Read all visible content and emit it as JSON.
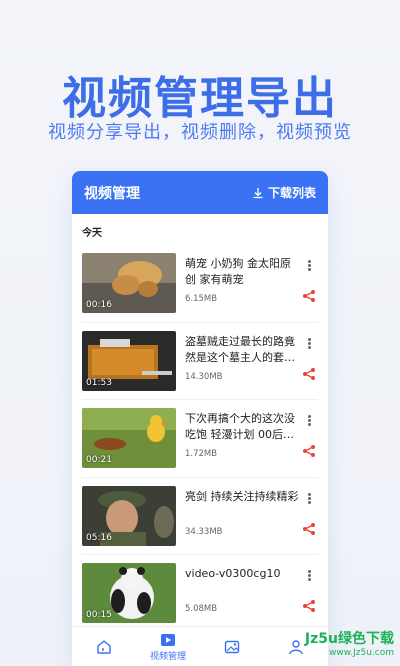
{
  "hero": {
    "title": "视频管理导出",
    "subtitle": "视频分享导出，视频删除，视频预览"
  },
  "app": {
    "title": "视频管理",
    "download_label": "下载列表",
    "section_label": "今天",
    "accent": "#3b72f3",
    "share_color": "#e8453c"
  },
  "videos": [
    {
      "title": "萌宠 小奶狗 金太阳原创 家有萌宠",
      "size": "6.15MB",
      "duration": "00:16"
    },
    {
      "title": "盗墓贼走过最长的路竟然是这个墓主人的套…",
      "size": "14.30MB",
      "duration": "01:53"
    },
    {
      "title": "下次再搞个大的这次没吃饱 轻漫计划 00后…",
      "size": "1.72MB",
      "duration": "00:21"
    },
    {
      "title": "亮剑 持续关注持续精彩",
      "size": "34.33MB",
      "duration": "05:16"
    },
    {
      "title": "video-v0300cg10",
      "size": "5.08MB",
      "duration": "00:15"
    }
  ],
  "nav": {
    "items": [
      {
        "icon": "home-icon",
        "label": ""
      },
      {
        "icon": "video-icon",
        "label": "视频管理"
      },
      {
        "icon": "image-icon",
        "label": ""
      },
      {
        "icon": "user-icon",
        "label": ""
      }
    ]
  },
  "watermark": {
    "main": "Jz5u绿色下载",
    "url": "www.Jz5u.com"
  }
}
